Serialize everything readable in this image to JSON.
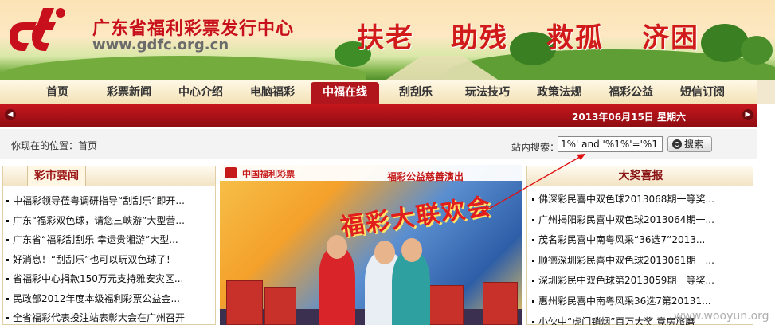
{
  "site": {
    "name": "广东省福利彩票发行中心",
    "url": "www.gdfc.org.cn",
    "slogans": [
      "扶老",
      "助残",
      "救孤",
      "济困"
    ]
  },
  "nav": {
    "items": [
      "首页",
      "彩票新闻",
      "中心介绍",
      "电脑福彩",
      "中福在线",
      "刮刮乐",
      "玩法技巧",
      "政策法规",
      "福彩公益",
      "短信订阅"
    ],
    "active_index": 4
  },
  "datebar": {
    "date": "2013年06月15日",
    "weekday": "星期六"
  },
  "location": {
    "text": "你现在的位置：首页"
  },
  "search": {
    "label": "站内搜索：",
    "value": "1%' and '%1%'='%1",
    "button": "搜索"
  },
  "news": {
    "title": "彩市要闻",
    "items": [
      "中福彩领导莅粤调研指导“刮刮乐”即开...",
      "广东“福彩双色球，请您三峡游”大型营...",
      "广东省“福彩刮刮乐 幸运贵湘游”大型...",
      "好消息！“刮刮乐”也可以玩双色球了！",
      "省福彩中心捐款150万元支持雅安灾区...",
      "民政部2012年度本级福利彩票公益金...",
      "全省福彩代表投注站表彰大会在广州召开"
    ]
  },
  "photo": {
    "org": "中国福利彩票",
    "ribbon": "福彩公益慈善演出",
    "headline": "福彩大联欢会"
  },
  "winners": {
    "title": "大奖喜报",
    "items": [
      "佛深彩民喜中双色球2013068期一等奖...",
      "广州揭阳彩民喜中双色球2013064期一...",
      "茂名彩民喜中南粤风采“36选7”2013...",
      "顺德深圳彩民喜中双色球2013061期一...",
      "深圳彩民中双色球第2013059期一等奖...",
      "惠州彩民喜中南粤风采36选7第20131...",
      "小伙中“虎门销烟”百万大奖 竟房旅磨"
    ]
  },
  "watermark": "www.wooyun.org",
  "colors": {
    "brand_red": "#c8101c",
    "nav_active": "#b0161b",
    "redbar": "#a8121a",
    "section_title": "#9b1515"
  }
}
